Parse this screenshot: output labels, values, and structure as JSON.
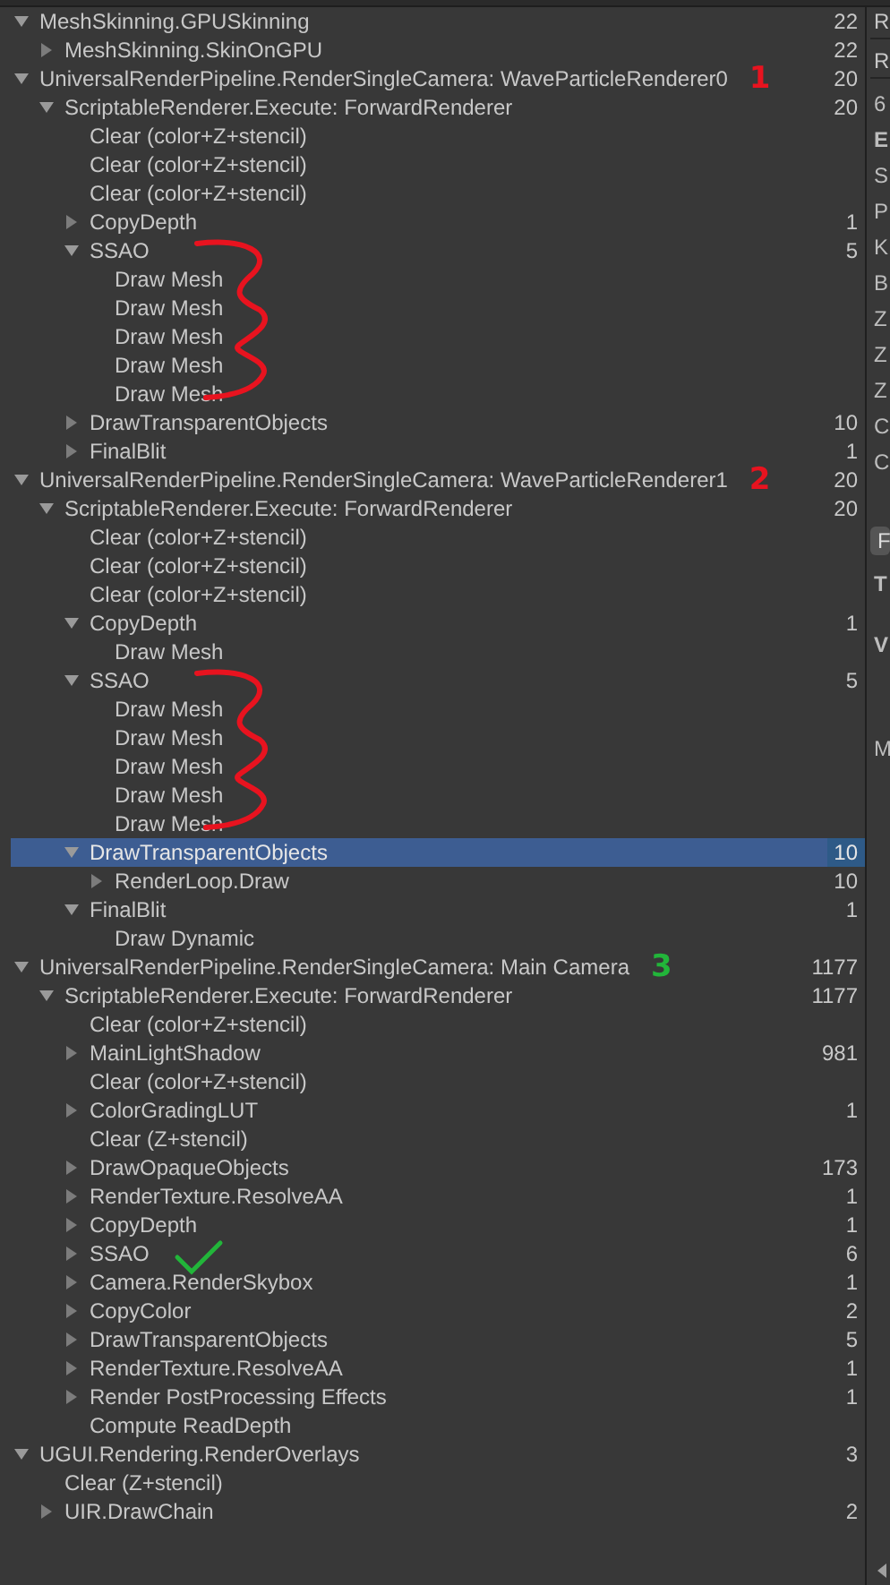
{
  "tree": [
    {
      "label": "MeshSkinning.GPUSkinning",
      "count": "22",
      "kind": "group",
      "expanded": true,
      "selected": false,
      "children": [
        {
          "label": "MeshSkinning.SkinOnGPU",
          "count": "22",
          "kind": "group",
          "expanded": false,
          "selected": false
        }
      ]
    },
    {
      "label": "UniversalRenderPipeline.RenderSingleCamera: WaveParticleRenderer0",
      "count": "20",
      "kind": "group",
      "expanded": true,
      "selected": false,
      "mark": {
        "kind": "digit",
        "text": "1",
        "color": "#e8131f"
      },
      "children": [
        {
          "label": "ScriptableRenderer.Execute: ForwardRenderer",
          "count": "20",
          "kind": "group",
          "expanded": true,
          "selected": false,
          "children": [
            {
              "label": "Clear (color+Z+stencil)",
              "kind": "event",
              "selected": false
            },
            {
              "label": "Clear (color+Z+stencil)",
              "kind": "event",
              "selected": false
            },
            {
              "label": "Clear (color+Z+stencil)",
              "kind": "event",
              "selected": false
            },
            {
              "label": "CopyDepth",
              "count": "1",
              "kind": "group",
              "expanded": false,
              "selected": false
            },
            {
              "label": "SSAO",
              "count": "5",
              "kind": "group",
              "expanded": true,
              "selected": false,
              "mark": {
                "kind": "squiggle",
                "color": "#e8131f"
              },
              "children": [
                {
                  "label": "Draw Mesh",
                  "kind": "event",
                  "selected": false
                },
                {
                  "label": "Draw Mesh",
                  "kind": "event",
                  "selected": false
                },
                {
                  "label": "Draw Mesh",
                  "kind": "event",
                  "selected": false
                },
                {
                  "label": "Draw Mesh",
                  "kind": "event",
                  "selected": false
                },
                {
                  "label": "Draw Mesh",
                  "kind": "event",
                  "selected": false
                }
              ]
            },
            {
              "label": "DrawTransparentObjects",
              "count": "10",
              "kind": "group",
              "expanded": false,
              "selected": false
            },
            {
              "label": "FinalBlit",
              "count": "1",
              "kind": "group",
              "expanded": false,
              "selected": false
            }
          ]
        }
      ]
    },
    {
      "label": "UniversalRenderPipeline.RenderSingleCamera: WaveParticleRenderer1",
      "count": "20",
      "kind": "group",
      "expanded": true,
      "selected": false,
      "mark": {
        "kind": "digit",
        "text": "2",
        "color": "#e8131f"
      },
      "children": [
        {
          "label": "ScriptableRenderer.Execute: ForwardRenderer",
          "count": "20",
          "kind": "group",
          "expanded": true,
          "selected": false,
          "children": [
            {
              "label": "Clear (color+Z+stencil)",
              "kind": "event",
              "selected": false
            },
            {
              "label": "Clear (color+Z+stencil)",
              "kind": "event",
              "selected": false
            },
            {
              "label": "Clear (color+Z+stencil)",
              "kind": "event",
              "selected": false
            },
            {
              "label": "CopyDepth",
              "count": "1",
              "kind": "group",
              "expanded": true,
              "selected": false,
              "children": [
                {
                  "label": "Draw Mesh",
                  "kind": "event",
                  "selected": false
                }
              ]
            },
            {
              "label": "SSAO",
              "count": "5",
              "kind": "group",
              "expanded": true,
              "selected": false,
              "mark": {
                "kind": "squiggle",
                "color": "#e8131f"
              },
              "children": [
                {
                  "label": "Draw Mesh",
                  "kind": "event",
                  "selected": false
                },
                {
                  "label": "Draw Mesh",
                  "kind": "event",
                  "selected": false
                },
                {
                  "label": "Draw Mesh",
                  "kind": "event",
                  "selected": false
                },
                {
                  "label": "Draw Mesh",
                  "kind": "event",
                  "selected": false
                },
                {
                  "label": "Draw Mesh",
                  "kind": "event",
                  "selected": false
                }
              ]
            },
            {
              "label": "DrawTransparentObjects",
              "count": "10",
              "kind": "group",
              "expanded": true,
              "selected": true,
              "children": [
                {
                  "label": "RenderLoop.Draw",
                  "count": "10",
                  "kind": "group",
                  "expanded": false,
                  "selected": false
                }
              ]
            },
            {
              "label": "FinalBlit",
              "count": "1",
              "kind": "group",
              "expanded": true,
              "selected": false,
              "children": [
                {
                  "label": "Draw Dynamic",
                  "kind": "event",
                  "selected": false
                }
              ]
            }
          ]
        }
      ]
    },
    {
      "label": "UniversalRenderPipeline.RenderSingleCamera: Main Camera",
      "count": "1177",
      "kind": "group",
      "expanded": true,
      "selected": false,
      "mark": {
        "kind": "digit",
        "text": "3",
        "color": "#22b53a"
      },
      "children": [
        {
          "label": "ScriptableRenderer.Execute: ForwardRenderer",
          "count": "1177",
          "kind": "group",
          "expanded": true,
          "selected": false,
          "children": [
            {
              "label": "Clear (color+Z+stencil)",
              "kind": "event",
              "selected": false
            },
            {
              "label": "MainLightShadow",
              "count": "981",
              "kind": "group",
              "expanded": false,
              "selected": false
            },
            {
              "label": "Clear (color+Z+stencil)",
              "kind": "event",
              "selected": false
            },
            {
              "label": "ColorGradingLUT",
              "count": "1",
              "kind": "group",
              "expanded": false,
              "selected": false
            },
            {
              "label": "Clear (Z+stencil)",
              "kind": "event",
              "selected": false
            },
            {
              "label": "DrawOpaqueObjects",
              "count": "173",
              "kind": "group",
              "expanded": false,
              "selected": false
            },
            {
              "label": "RenderTexture.ResolveAA",
              "count": "1",
              "kind": "group",
              "expanded": false,
              "selected": false
            },
            {
              "label": "CopyDepth",
              "count": "1",
              "kind": "group",
              "expanded": false,
              "selected": false
            },
            {
              "label": "SSAO",
              "count": "6",
              "kind": "group",
              "expanded": false,
              "selected": false,
              "mark": {
                "kind": "check",
                "color": "#22b53a"
              }
            },
            {
              "label": "Camera.RenderSkybox",
              "count": "1",
              "kind": "group",
              "expanded": false,
              "selected": false
            },
            {
              "label": "CopyColor",
              "count": "2",
              "kind": "group",
              "expanded": false,
              "selected": false
            },
            {
              "label": "DrawTransparentObjects",
              "count": "5",
              "kind": "group",
              "expanded": false,
              "selected": false
            },
            {
              "label": "RenderTexture.ResolveAA",
              "count": "1",
              "kind": "group",
              "expanded": false,
              "selected": false
            },
            {
              "label": "Render PostProcessing Effects",
              "count": "1",
              "kind": "group",
              "expanded": false,
              "selected": false
            },
            {
              "label": "Compute ReadDepth",
              "kind": "event",
              "selected": false
            }
          ]
        }
      ]
    },
    {
      "label": "UGUI.Rendering.RenderOverlays",
      "count": "3",
      "kind": "group",
      "expanded": true,
      "selected": false,
      "children": [
        {
          "label": "Clear (Z+stencil)",
          "kind": "event",
          "selected": false
        },
        {
          "label": "UIR.DrawChain",
          "count": "2",
          "kind": "group",
          "expanded": false,
          "selected": false
        }
      ]
    }
  ],
  "details_panel": [
    {
      "kind": "field",
      "text": "R"
    },
    {
      "kind": "field",
      "text": "R"
    },
    {
      "kind": "label",
      "text": "6"
    },
    {
      "kind": "heading",
      "text": "E"
    },
    {
      "kind": "label",
      "text": "S"
    },
    {
      "kind": "label",
      "text": "P"
    },
    {
      "kind": "label",
      "text": "K"
    },
    {
      "kind": "label",
      "text": "B"
    },
    {
      "kind": "label",
      "text": "Z"
    },
    {
      "kind": "label",
      "text": "Z"
    },
    {
      "kind": "label",
      "text": "Z"
    },
    {
      "kind": "label",
      "text": "C"
    },
    {
      "kind": "label",
      "text": "C"
    },
    {
      "kind": "button",
      "text": "F"
    },
    {
      "kind": "heading",
      "text": "T"
    },
    {
      "kind": "heading",
      "text": "V"
    },
    {
      "kind": "label",
      "text": "M"
    }
  ]
}
